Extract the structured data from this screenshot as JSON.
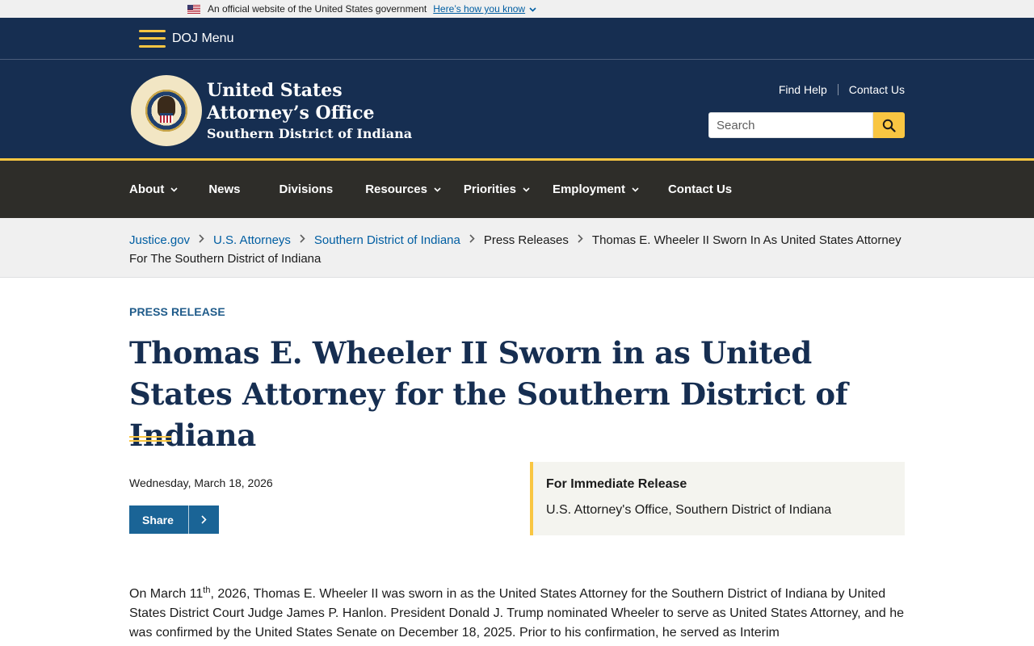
{
  "gov_banner": {
    "text": "An official website of the United States government",
    "link": "Here’s how you know"
  },
  "doj_bar": {
    "menu_label": "DOJ Menu"
  },
  "header": {
    "agency_line1": "United States",
    "agency_line2": "Attorney’s Office",
    "agency_line3": "Southern District of Indiana",
    "util_links": [
      "Find Help",
      "Contact Us"
    ],
    "search_placeholder": "Search"
  },
  "nav": {
    "items": [
      {
        "label": "About",
        "dropdown": true
      },
      {
        "label": "News",
        "dropdown": false
      },
      {
        "label": "Divisions",
        "dropdown": false
      },
      {
        "label": "Resources",
        "dropdown": true
      },
      {
        "label": "Priorities",
        "dropdown": true
      },
      {
        "label": "Employment",
        "dropdown": true
      },
      {
        "label": "Contact Us",
        "dropdown": false
      }
    ]
  },
  "breadcrumb": {
    "items": [
      "Justice.gov",
      "U.S. Attorneys",
      "Southern District of Indiana",
      "Press Releases"
    ],
    "current": "Thomas E. Wheeler II Sworn In As United States Attorney For The Southern District of Indiana"
  },
  "article": {
    "eyebrow": "PRESS RELEASE",
    "title": "Thomas E. Wheeler II Sworn in as United States Attorney for the Southern District of Indiana",
    "date": "Wednesday, March 18, 2026",
    "share_label": "Share",
    "release_heading": "For Immediate Release",
    "release_office": "U.S. Attorney's Office, Southern District of Indiana",
    "body_pre": "On March 11",
    "body_sup": "th",
    "body_post": ", 2026, Thomas E. Wheeler II was sworn in as the United States Attorney for the Southern District of Indiana by United States District Court Judge James P. Hanlon. President Donald J. Trump nominated Wheeler to serve as United States Attorney, and he was confirmed by the United States Senate on December 18, 2025. Prior to his confirmation, he served as Interim"
  },
  "colors": {
    "navy": "#162e51",
    "gold": "#f9c642",
    "nav_dark": "#2e2d29",
    "link_blue": "#005ea2"
  }
}
